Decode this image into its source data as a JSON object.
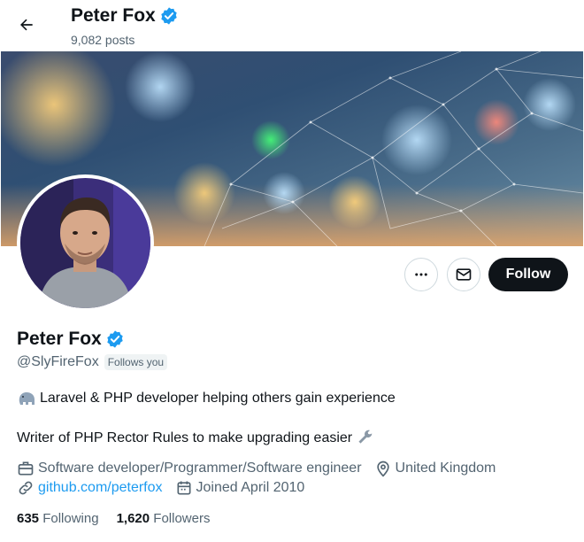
{
  "header": {
    "name": "Peter Fox",
    "posts": "9,082 posts"
  },
  "profile": {
    "name": "Peter Fox",
    "handle": "@SlyFireFox",
    "follows_you": "Follows you",
    "bio_line1": "Laravel & PHP developer helping others gain experience",
    "bio_line2": "Writer of PHP Rector Rules to make upgrading easier",
    "profession": "Software developer/Programmer/Software engineer",
    "location": "United Kingdom",
    "website": "github.com/peterfox",
    "joined": "Joined April 2010"
  },
  "actions": {
    "follow_label": "Follow"
  },
  "stats": {
    "following_count": "635",
    "following_label": "Following",
    "followers_count": "1,620",
    "followers_label": "Followers"
  },
  "icons": {
    "back": "arrow-left-icon",
    "verified": "verified-badge-icon",
    "more": "ellipsis-icon",
    "message": "envelope-icon",
    "briefcase": "briefcase-icon",
    "location": "map-pin-icon",
    "link": "link-icon",
    "calendar": "calendar-icon",
    "elephant": "elephant-emoji",
    "wrench": "wrench-emoji"
  },
  "colors": {
    "accent": "#1d9bf0",
    "text": "#0f1419",
    "muted": "#536471",
    "follow_bg": "#0f1419"
  }
}
